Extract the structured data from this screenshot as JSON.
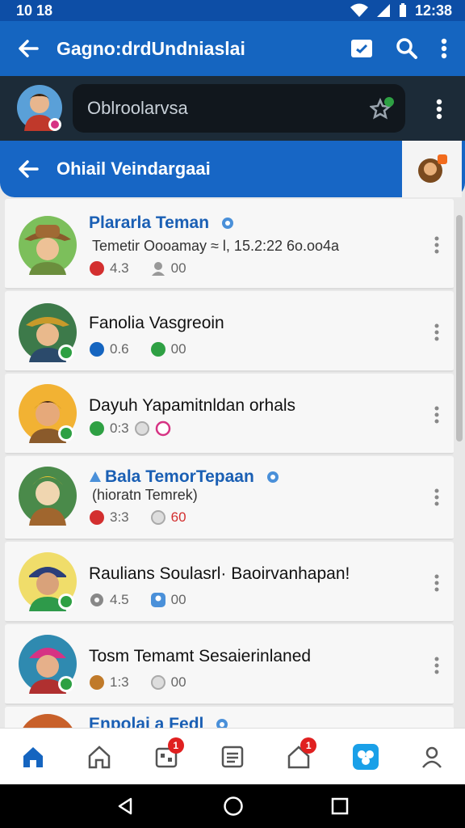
{
  "status": {
    "time": "10 18",
    "clock": "12:38"
  },
  "appbar": {
    "title": "Gagno:drdUndniaslai"
  },
  "conversation": {
    "input_value": "Oblroolarvsa"
  },
  "subbar": {
    "title": "Ohiail Veindargaai"
  },
  "contacts": [
    {
      "name": "Plararla Teman",
      "sub": "Temetir Oooamay ≈ l, 15.2:22 6o.oo4a",
      "stat1": "4.3",
      "stat2": "00"
    },
    {
      "name": "Fanolia Vasgreoin",
      "sub": "",
      "stat1": "0.6",
      "stat2": "00"
    },
    {
      "name": "Dayuh Yapamitnldan orhals",
      "sub": "",
      "stat1": "0:3",
      "stat2": ""
    },
    {
      "name": "Bala TemorTepaan",
      "sub": "(hioratn Temrek)",
      "stat1": "3:3",
      "stat2": "60"
    },
    {
      "name": "Raulians Soulasrl· Baoirvanhapan!",
      "sub": "",
      "stat1": "4.5",
      "stat2": "00"
    },
    {
      "name": "Tosm Temamt Sesaierinlaned",
      "sub": "",
      "stat1": "1:3",
      "stat2": "00"
    },
    {
      "name": "Enpolai a Fedl",
      "sub": "",
      "stat1": "",
      "stat2": ""
    }
  ],
  "nav": {
    "badge_a": "1",
    "badge_b": "1"
  },
  "colors": {
    "primary": "#1565c0",
    "dark": "#1c2b38",
    "accent_blue": "#1a5fb4",
    "badge_red": "#e02020"
  }
}
